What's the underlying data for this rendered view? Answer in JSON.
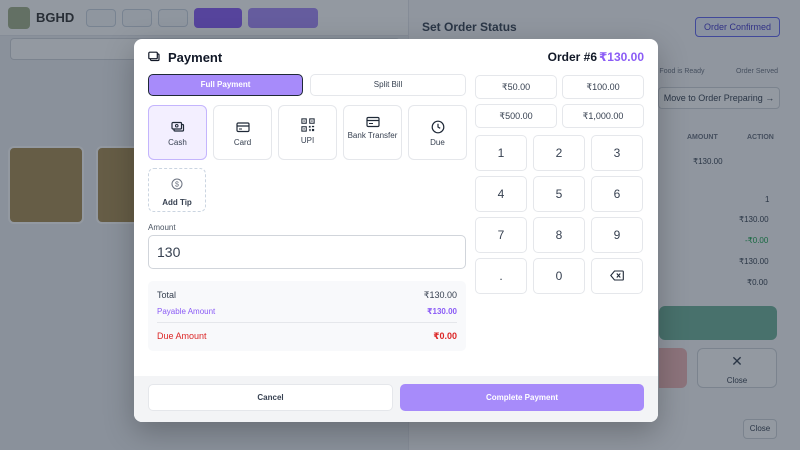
{
  "app": {
    "brand": "BGHD"
  },
  "right_panel": {
    "title": "Set Order Status",
    "status_badge": "Order Confirmed",
    "steps": [
      "Food is Ready",
      "Order Served"
    ],
    "move_button": "Move to Order Preparing →",
    "headers": [
      "AMOUNT",
      "ACTION"
    ],
    "item_amount": "₹130.00",
    "quantity": "1",
    "subtotal": "₹130.00",
    "discount": "-₹0.00",
    "total": "₹130.00",
    "due": "₹0.00",
    "close_card_label": "Close",
    "close_button": "Close"
  },
  "modal": {
    "title": "Payment",
    "order_label": "Order #6",
    "order_amount": "₹130.00",
    "tabs": {
      "full": "Full Payment",
      "split": "Split Bill"
    },
    "methods": [
      {
        "label": "Cash",
        "icon": "cash-icon",
        "selected": true
      },
      {
        "label": "Card",
        "icon": "card-icon",
        "selected": false
      },
      {
        "label": "UPI",
        "icon": "qr-icon",
        "selected": false
      },
      {
        "label": "Bank Transfer",
        "icon": "bank-icon",
        "selected": false
      },
      {
        "label": "Due",
        "icon": "clock-icon",
        "selected": false
      }
    ],
    "tip_label": "Add Tip",
    "amount_label": "Amount",
    "amount_value": "130",
    "summary": {
      "total_label": "Total",
      "total_value": "₹130.00",
      "payable_label": "Payable Amount",
      "payable_value": "₹130.00",
      "due_label": "Due Amount",
      "due_value": "₹0.00"
    },
    "quick_amounts": [
      "₹50.00",
      "₹100.00",
      "₹500.00",
      "₹1,000.00"
    ],
    "keypad": [
      "1",
      "2",
      "3",
      "4",
      "5",
      "6",
      "7",
      "8",
      "9",
      ".",
      "0"
    ],
    "cancel_label": "Cancel",
    "complete_label": "Complete Payment"
  },
  "colors": {
    "accent": "#a78bfa",
    "accent_text": "#8b5cf6",
    "danger": "#dc2626"
  }
}
